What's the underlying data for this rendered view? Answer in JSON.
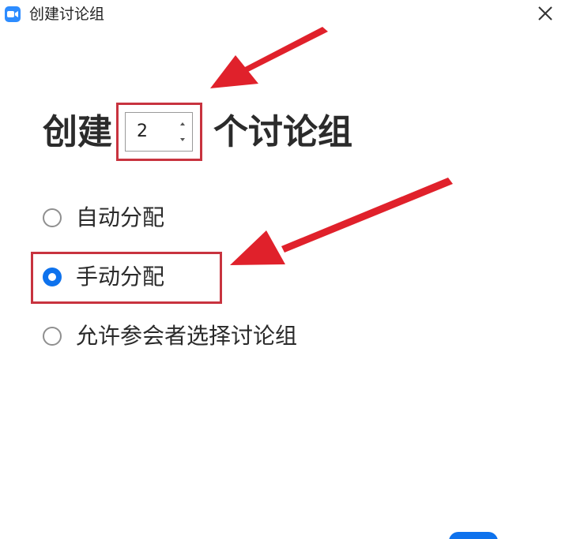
{
  "window": {
    "title": "创建讨论组"
  },
  "heading": {
    "prefix": "创建",
    "count": "2",
    "suffix": "个讨论组"
  },
  "options": [
    {
      "label": "自动分配",
      "checked": false
    },
    {
      "label": "手动分配",
      "checked": true
    },
    {
      "label": "允许参会者选择讨论组",
      "checked": false
    }
  ],
  "colors": {
    "accent": "#0e72ed",
    "highlight": "#c8333f",
    "arrow": "#e0212b",
    "app_icon": "#2d8cff"
  },
  "icons": {
    "app": "zoom-camera-icon",
    "close": "close-icon",
    "stepper_up": "caret-up-icon",
    "stepper_down": "caret-down-icon"
  }
}
